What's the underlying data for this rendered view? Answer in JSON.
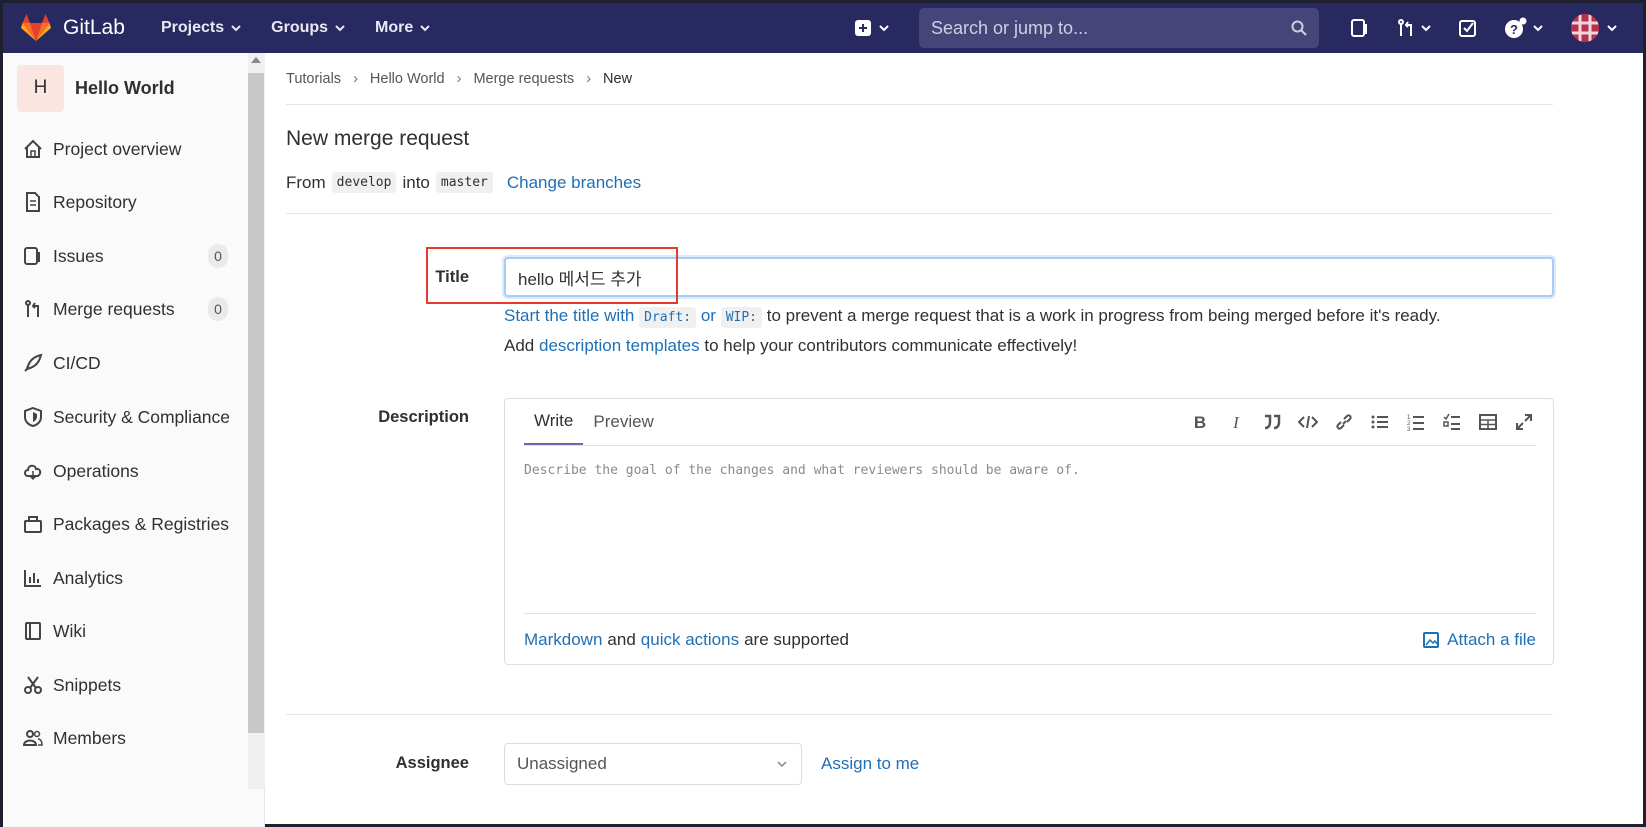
{
  "topbar": {
    "brand": "GitLab",
    "nav": [
      {
        "label": "Projects"
      },
      {
        "label": "Groups"
      },
      {
        "label": "More"
      }
    ],
    "search_placeholder": "Search or jump to..."
  },
  "sidebar": {
    "project_initial": "H",
    "project_name": "Hello World",
    "items": [
      {
        "label": "Project overview",
        "icon": "home-icon"
      },
      {
        "label": "Repository",
        "icon": "doc-icon"
      },
      {
        "label": "Issues",
        "icon": "issues-icon",
        "badge": "0"
      },
      {
        "label": "Merge requests",
        "icon": "merge-request-icon",
        "badge": "0"
      },
      {
        "label": "CI/CD",
        "icon": "rocket-icon"
      },
      {
        "label": "Security & Compliance",
        "icon": "shield-icon"
      },
      {
        "label": "Operations",
        "icon": "cloud-icon"
      },
      {
        "label": "Packages & Registries",
        "icon": "package-icon"
      },
      {
        "label": "Analytics",
        "icon": "chart-icon"
      },
      {
        "label": "Wiki",
        "icon": "book-icon"
      },
      {
        "label": "Snippets",
        "icon": "scissors-icon"
      },
      {
        "label": "Members",
        "icon": "users-icon"
      }
    ]
  },
  "breadcrumb": [
    "Tutorials",
    "Hello World",
    "Merge requests",
    "New"
  ],
  "page": {
    "title": "New merge request",
    "from_label": "From",
    "source_branch": "develop",
    "into_label": "into",
    "target_branch": "master",
    "change_branches": "Change branches"
  },
  "form": {
    "title_label": "Title",
    "title_value": "hello 메서드 추가",
    "hint1_link": "Start the title with",
    "hint1_code1": "Draft:",
    "hint1_or": "or",
    "hint1_code2": "WIP:",
    "hint1_rest": "to prevent a merge request that is a work in progress from being merged before it's ready.",
    "hint2_pre": "Add",
    "hint2_link": "description templates",
    "hint2_rest": "to help your contributors communicate effectively!",
    "description_label": "Description",
    "tab_write": "Write",
    "tab_preview": "Preview",
    "description_placeholder": "Describe the goal of the changes and what reviewers should be aware of.",
    "markdown_link": "Markdown",
    "and_text": "and",
    "quick_actions_link": "quick actions",
    "supported_text": "are supported",
    "attach_file": "Attach a file",
    "assignee_label": "Assignee",
    "assignee_value": "Unassigned",
    "assign_to_me": "Assign to me"
  },
  "colors": {
    "nav_bg": "#292961",
    "link": "#1f6fb5",
    "highlight_box": "#e53a2e"
  }
}
